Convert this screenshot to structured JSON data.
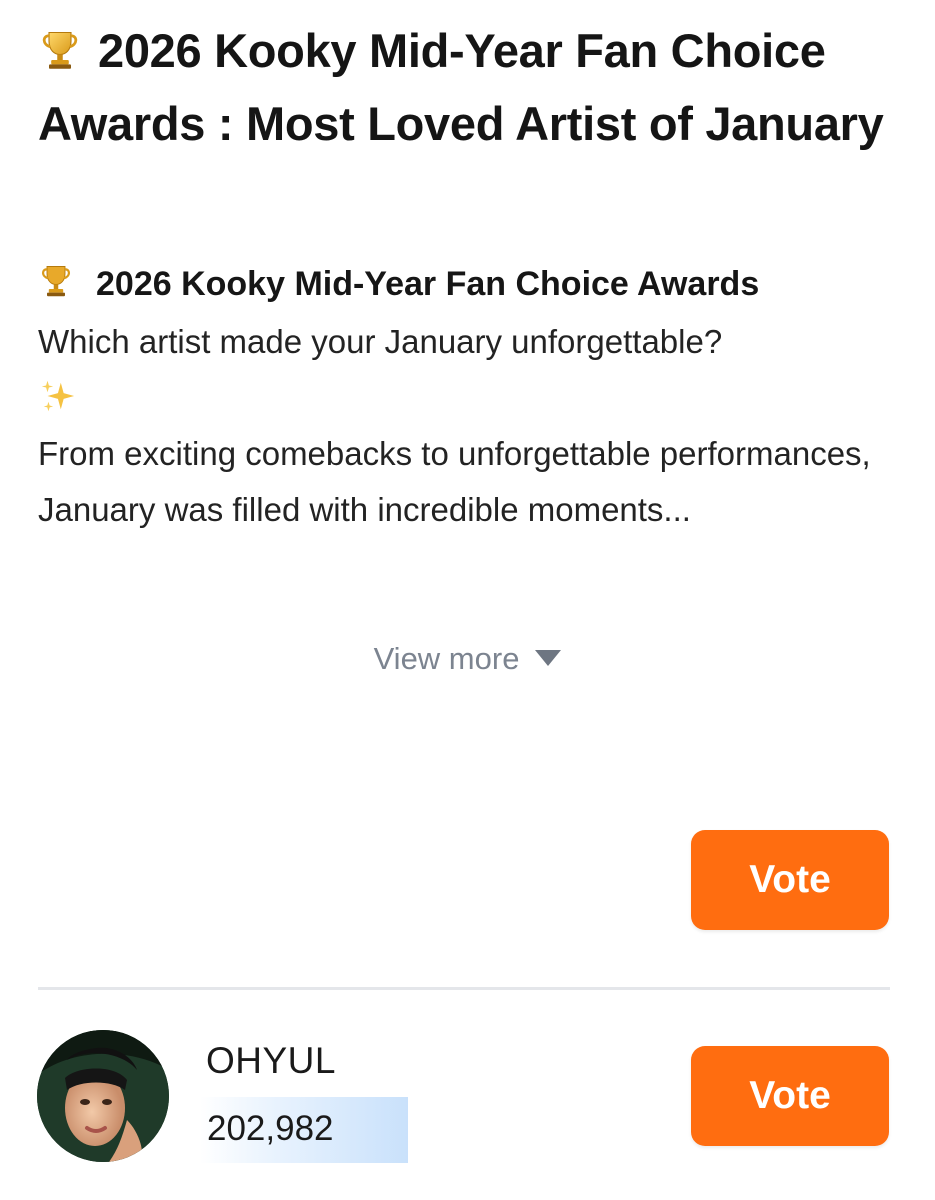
{
  "poll": {
    "title": "2026 Kooky Mid-Year Fan Choice Awards : Most Loved Artist of January",
    "description": {
      "heading": "2026 Kooky Mid-Year Fan Choice Awards",
      "question": "Which artist made your January unforgettable?",
      "body": "From exciting comebacks to unforgettable performances, January was filled with incredible moments..."
    },
    "view_more_label": "View more"
  },
  "vote_button_label": "Vote",
  "candidates": [
    {
      "name": "OHYUL",
      "votes": "202,982"
    }
  ],
  "icons": {
    "title_icon": "trophy-icon",
    "heading_icon": "trophy-icon",
    "sparkle": "sparkles-icon",
    "expand": "caret-down-icon"
  },
  "colors": {
    "accent": "#ff6d10",
    "muted_text": "#7c8490",
    "vote_bar": "#c9e1fb"
  }
}
